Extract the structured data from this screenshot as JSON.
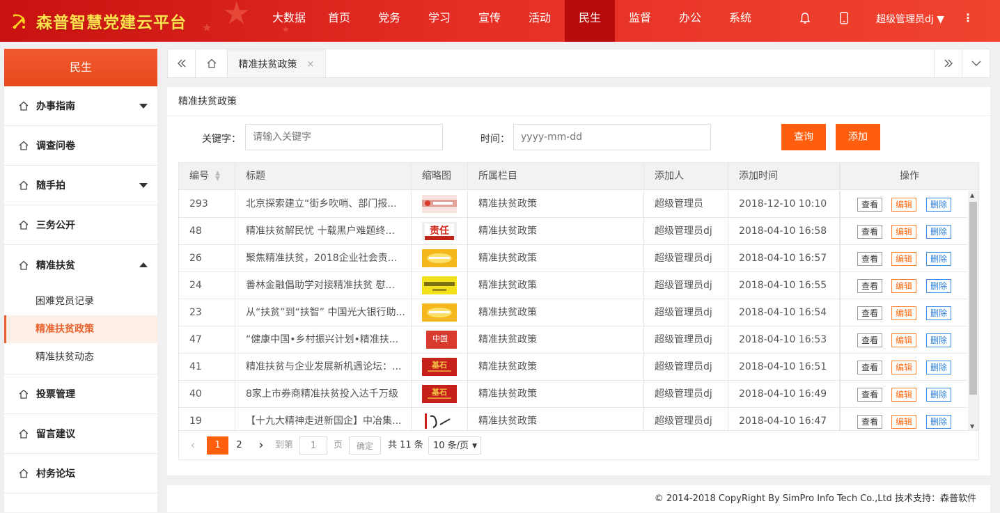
{
  "header": {
    "app_title": "森普智慧党建云平台",
    "nav": [
      "大数据",
      "首页",
      "党务",
      "学习",
      "宣传",
      "活动",
      "民生",
      "监督",
      "办公",
      "系统"
    ],
    "active_nav": "民生",
    "user_name": "超级管理员dj",
    "brand_color": "#e52d24"
  },
  "sidebar": {
    "title": "民生",
    "items": [
      {
        "label": "办事指南",
        "caret": "down"
      },
      {
        "label": "调查问卷",
        "caret": ""
      },
      {
        "label": "随手拍",
        "caret": "down"
      },
      {
        "label": "三务公开",
        "caret": ""
      },
      {
        "label": "精准扶贫",
        "caret": "up"
      }
    ],
    "subitems": [
      "困难党员记录",
      "精准扶贫政策",
      "精准扶贫动态"
    ],
    "active_subitem": "精准扶贫政策",
    "items_after": [
      "投票管理",
      "留言建议",
      "村务论坛"
    ]
  },
  "tabs": {
    "active_tab": "精准扶贫政策",
    "close_glyph": "×"
  },
  "page": {
    "title": "精准扶贫政策",
    "keyword_label": "关键字：",
    "keyword_placeholder": "请输入关键字",
    "time_label": "时间：",
    "time_placeholder": "yyyy-mm-dd",
    "query_button": "查询",
    "add_button": "添加"
  },
  "table": {
    "headers": [
      "编号",
      "标题",
      "缩略图",
      "所属栏目",
      "添加人",
      "添加时间",
      "操作"
    ],
    "actions": {
      "view": "查看",
      "edit": "编辑",
      "delete": "删除"
    },
    "rows": [
      {
        "id": "293",
        "title": "北京探索建立“街乡吹哨、部门报...",
        "category": "精准扶贫政策",
        "author": "超级管理员",
        "time": "2018-12-10 10:10",
        "thumb": "red-banner"
      },
      {
        "id": "48",
        "title": "精准扶贫解民忧 十载黑户难题终...",
        "category": "精准扶贫政策",
        "author": "超级管理员dj",
        "time": "2018-04-10 16:58",
        "thumb": "red-text"
      },
      {
        "id": "26",
        "title": "聚焦精准扶贫，2018企业社会责...",
        "category": "精准扶贫政策",
        "author": "超级管理员dj",
        "time": "2018-04-10 16:57",
        "thumb": "yellow"
      },
      {
        "id": "24",
        "title": "善林金融倡助学对接精准扶贫 慰...",
        "category": "精准扶贫政策",
        "author": "超级管理员dj",
        "time": "2018-04-10 16:55",
        "thumb": "yellow-text"
      },
      {
        "id": "23",
        "title": "从“扶贫”到“扶智” 中国光大银行助...",
        "category": "精准扶贫政策",
        "author": "超级管理员dj",
        "time": "2018-04-10 16:54",
        "thumb": "yellow"
      },
      {
        "id": "47",
        "title": "“健康中国•乡村振兴计划•精准扶...",
        "category": "精准扶贫政策",
        "author": "超级管理员dj",
        "time": "2018-04-10 16:53",
        "thumb": "red-zhongguo"
      },
      {
        "id": "41",
        "title": "精准扶贫与企业发展新机遇论坛：...",
        "category": "精准扶贫政策",
        "author": "超级管理员dj",
        "time": "2018-04-10 16:51",
        "thumb": "red-stone"
      },
      {
        "id": "40",
        "title": "8家上市券商精准扶贫投入达千万级",
        "category": "精准扶贫政策",
        "author": "超级管理员dj",
        "time": "2018-04-10 16:49",
        "thumb": "red-stone"
      },
      {
        "id": "19",
        "title": "【十九大精神走进新国企】中冶集...",
        "category": "精准扶贫政策",
        "author": "超级管理员dj",
        "time": "2018-04-10 16:47",
        "thumb": "calligraphy"
      }
    ]
  },
  "pager": {
    "prev": "‹",
    "pages": [
      "1",
      "2"
    ],
    "current": "1",
    "next": "›",
    "goto_label": "到第",
    "goto_value": "1",
    "page_unit": "页",
    "confirm": "确定",
    "total": "共 11 条",
    "per_page": "10 条/页"
  },
  "footer": {
    "text": "© 2014-2018 CopyRight By SimPro Info Tech Co.,Ltd 技术支持：森普软件"
  },
  "colors": {
    "orange": "#ff5e0e",
    "sidebar_header": "#f05a2e",
    "active_sub": "#e8622d"
  }
}
